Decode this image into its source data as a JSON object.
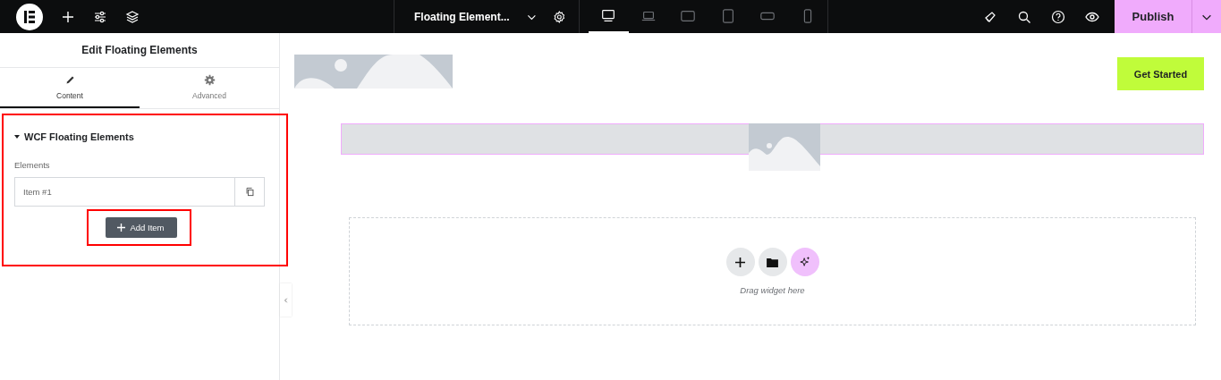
{
  "top_bar": {
    "page_title": "Floating Element...",
    "devices": [
      {
        "selected": true
      },
      {
        "selected": false
      },
      {
        "selected": false
      },
      {
        "selected": false
      },
      {
        "selected": false
      },
      {
        "selected": false
      }
    ],
    "publish": "Publish"
  },
  "panel": {
    "title": "Edit Floating Elements",
    "tabs": [
      {
        "label": "Content",
        "selected": true
      },
      {
        "label": "Advanced",
        "selected": false
      }
    ],
    "section": {
      "title": "WCF Floating Elements",
      "expanded": true
    },
    "field_label": "Elements",
    "items": [
      {
        "label": "Item #1"
      }
    ],
    "add_label": "Add Item"
  },
  "canvas": {
    "button": "Get Started",
    "drop_hint": "Drag widget here"
  }
}
